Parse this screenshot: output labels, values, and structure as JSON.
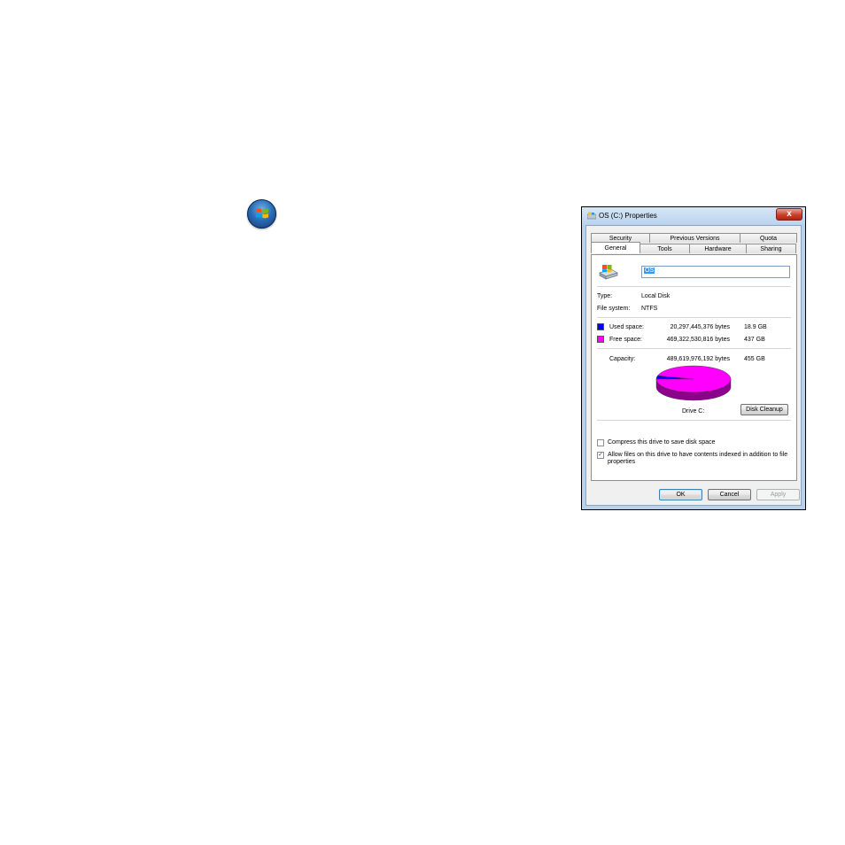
{
  "dialog": {
    "title": "OS (C:) Properties",
    "close_glyph": "x",
    "tabs_back": [
      "Security",
      "Previous Versions",
      "Quota"
    ],
    "tabs_front": [
      "General",
      "Tools",
      "Hardware",
      "Sharing"
    ],
    "active_tab": "General",
    "drive_name": "OS",
    "type_label": "Type:",
    "type_value": "Local Disk",
    "fs_label": "File system:",
    "fs_value": "NTFS",
    "used": {
      "label": "Used space:",
      "bytes": "20,297,445,376 bytes",
      "size": "18.9 GB",
      "color": "#0000ff"
    },
    "free": {
      "label": "Free space:",
      "bytes": "469,322,530,816 bytes",
      "size": "437 GB",
      "color": "#ff00ff"
    },
    "capacity": {
      "label": "Capacity:",
      "bytes": "489,619,976,192 bytes",
      "size": "455 GB"
    },
    "drive_caption": "Drive C:",
    "disk_cleanup": "Disk Cleanup",
    "compress_label": "Compress this drive to save disk space",
    "compress_checked": false,
    "index_label": "Allow files on this drive to have contents indexed in addition to file properties",
    "index_checked": true,
    "ok": "OK",
    "cancel": "Cancel",
    "apply": "Apply"
  },
  "chart_data": {
    "type": "pie",
    "categories": [
      "Used space",
      "Free space"
    ],
    "values": [
      18.9,
      437
    ],
    "colors": [
      "#0000ff",
      "#ff00ff"
    ]
  }
}
